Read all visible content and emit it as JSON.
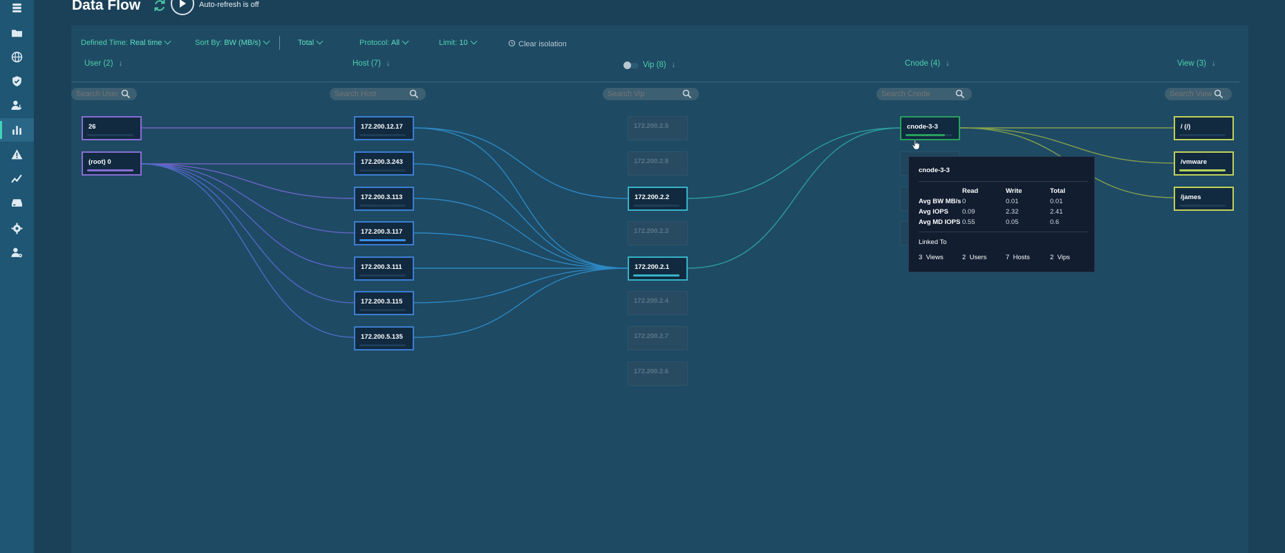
{
  "page": {
    "title": "Data Flow",
    "auto_refresh": "Auto-refresh is off"
  },
  "filters": {
    "defined_time": {
      "label": "Defined Time:",
      "value": "Real time"
    },
    "sort_by": {
      "label": "Sort By:",
      "value": "BW (MB/s)"
    },
    "total": "Total",
    "protocol": {
      "label": "Protocol:",
      "value": "All"
    },
    "limit": {
      "label": "Limit:",
      "value": "10"
    },
    "clear_isolation": "Clear isolation"
  },
  "columns": {
    "user": {
      "label": "User (2)",
      "search_placeholder": "Search User"
    },
    "host": {
      "label": "Host (7)",
      "search_placeholder": "Search Host"
    },
    "vip": {
      "label": "Vip (8)",
      "search_placeholder": "Search Vip"
    },
    "cnode": {
      "label": "Cnode (4)",
      "search_placeholder": "Search Cnode"
    },
    "view": {
      "label": "View (3)",
      "search_placeholder": "Search View"
    }
  },
  "users": [
    {
      "label": "26",
      "bar_fraction": 0.0,
      "bar_color": "#1e3d56"
    },
    {
      "label": "(root) 0",
      "bar_fraction": 1.0,
      "bar_color": "#8a6fd6"
    }
  ],
  "hosts": [
    {
      "label": "172.200.12.17",
      "bar_fraction": 0.0
    },
    {
      "label": "172.200.3.243",
      "bar_fraction": 0.0
    },
    {
      "label": "172.200.3.113",
      "bar_fraction": 0.0
    },
    {
      "label": "172.200.3.117",
      "bar_fraction": 1.0
    },
    {
      "label": "172.200.3.111",
      "bar_fraction": 0.0
    },
    {
      "label": "172.200.3.115",
      "bar_fraction": 0.0
    },
    {
      "label": "172.200.5.135",
      "bar_fraction": 0.0
    }
  ],
  "vips": [
    {
      "label": "172.200.2.5",
      "active": false
    },
    {
      "label": "172.200.2.8",
      "active": false
    },
    {
      "label": "172.200.2.2",
      "active": true,
      "bar_fraction": 0.0
    },
    {
      "label": "172.200.2.3",
      "active": false
    },
    {
      "label": "172.200.2.1",
      "active": true,
      "bar_fraction": 1.0
    },
    {
      "label": "172.200.2.4",
      "active": false
    },
    {
      "label": "172.200.2.7",
      "active": false
    },
    {
      "label": "172.200.2.6",
      "active": false
    }
  ],
  "cnodes": [
    {
      "label": "cnode-3-3",
      "bar_fraction": 0.85
    }
  ],
  "views": [
    {
      "label": "/ (/)",
      "bar_fraction": 0.0
    },
    {
      "label": "/vmware",
      "bar_fraction": 1.0
    },
    {
      "label": "/james",
      "bar_fraction": 0.0
    }
  ],
  "tooltip": {
    "title": "cnode-3-3",
    "headers": [
      "Read",
      "Write",
      "Total"
    ],
    "rows": [
      {
        "label": "Avg BW MB/s",
        "read": "0",
        "write": "0.01",
        "total": "0.01"
      },
      {
        "label": "Avg IOPS",
        "read": "0.09",
        "write": "2.32",
        "total": "2.41"
      },
      {
        "label": "Avg MD IOPS",
        "read": "0.55",
        "write": "0.05",
        "total": "0.6"
      }
    ],
    "linked_title": "Linked To",
    "linked": [
      {
        "count": "3",
        "label": "Views"
      },
      {
        "count": "2",
        "label": "Users"
      },
      {
        "count": "7",
        "label": "Hosts"
      },
      {
        "count": "2",
        "label": "Vips"
      }
    ]
  },
  "colors": {
    "accent": "#4fd1ad",
    "user_border": "#8a6fd6",
    "host_border": "#3c7fd2",
    "vip_border": "#36b4c8",
    "cnode_border": "#27a15c",
    "view_border": "#c3d35a"
  },
  "icons": {
    "sidebar": [
      "database-icon",
      "folders-icon",
      "globe-icon",
      "shield-icon",
      "user-transfer-icon",
      "bar-chart-icon",
      "alert-icon",
      "line-chart-icon",
      "drive-icon",
      "gear-icon",
      "user-settings-icon"
    ]
  }
}
